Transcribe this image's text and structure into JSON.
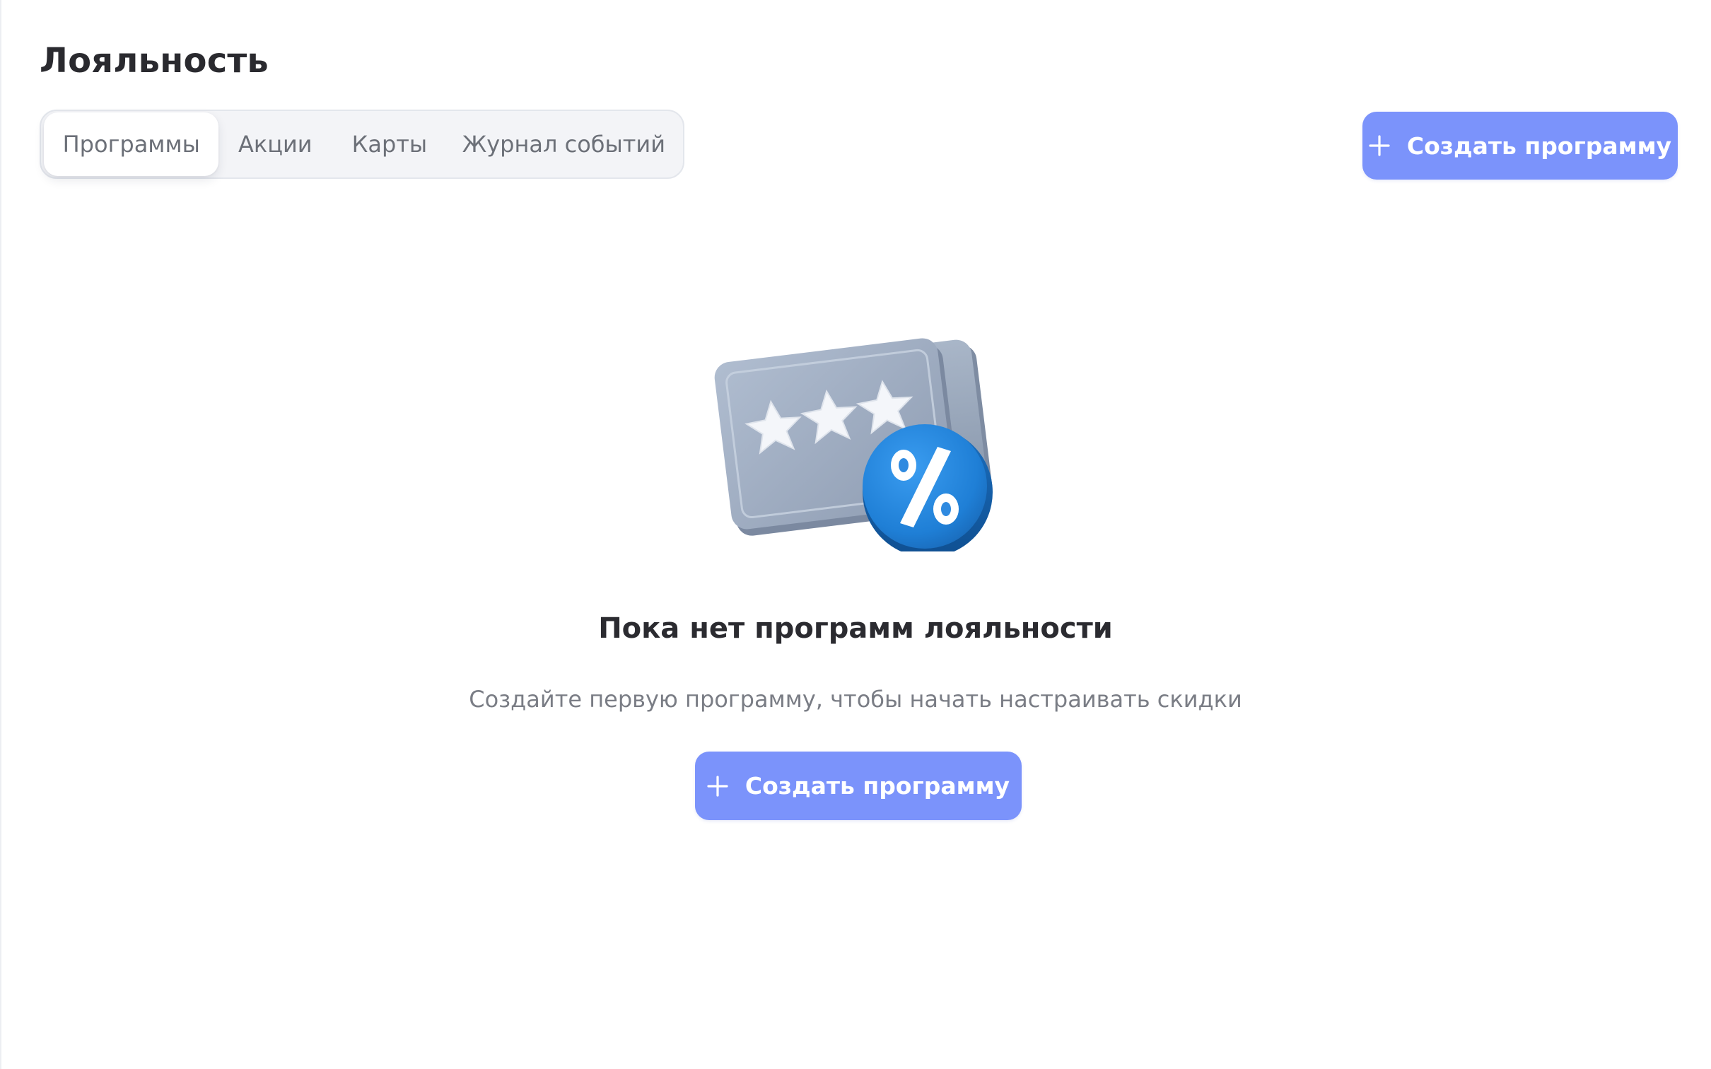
{
  "page": {
    "title": "Лояльность"
  },
  "tabs": [
    {
      "label": "Программы",
      "active": true
    },
    {
      "label": "Акции",
      "active": false
    },
    {
      "label": "Карты",
      "active": false
    },
    {
      "label": "Журнал событий",
      "active": false
    }
  ],
  "header": {
    "create_button_label": "Создать программу",
    "create_button_icon": "plus-icon"
  },
  "empty_state": {
    "illustration_icon": "loyalty-cards-percent-icon",
    "title": "Пока нет программ лояльности",
    "subtitle": "Создайте первую программу, чтобы начать настраивать скидки",
    "button_label": "Создать программу",
    "button_icon": "plus-icon"
  },
  "colors": {
    "accent": "#7b93fb",
    "badge": "#1f7fd6",
    "card": "#9aaac0",
    "text_primary": "#2a2a2f",
    "text_secondary": "#7a7d85"
  }
}
